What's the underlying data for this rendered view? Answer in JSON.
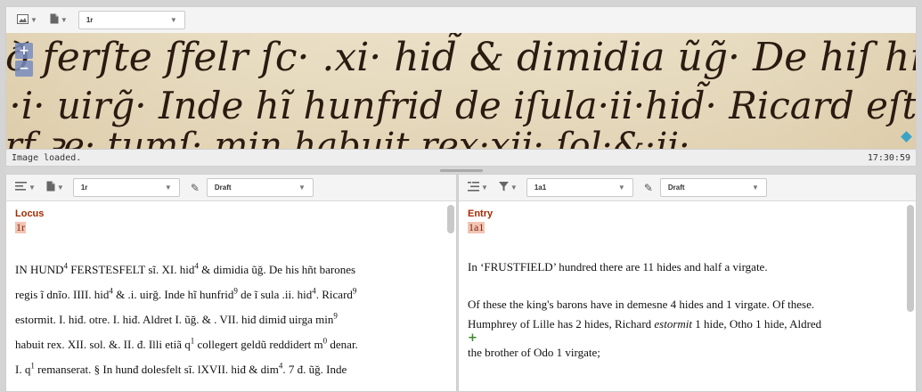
{
  "top_toolbar": {
    "image_icon": "image-icon",
    "page_icon": "page-icon",
    "folio_select": "1r"
  },
  "image_viewer": {
    "zoom_in": "+",
    "zoom_out": "−"
  },
  "status": {
    "message": "Image loaded.",
    "time": "17:30:59"
  },
  "left_panel": {
    "folio_select": "1r",
    "status_select": "Draft",
    "heading": "Locus",
    "locus_value": "1r",
    "lines": [
      [
        "IN HUND",
        "4",
        " FERSTESFELT sĩ. XI. hid",
        "4",
        " & dimidia ũğ. De his hñt barones"
      ],
      [
        "regis ĩ dnĩo. IIII. hid",
        "4",
        " & .i. uirğ. Inde hĩ hunfrid",
        "9",
        " de ĩ sula .ii. hid",
        "4",
        ". Ricard",
        "9",
        ""
      ],
      [
        "estormit. I. hiđ. otre. I. hiđ. Aldret I. ũğ. & . VII. hiđ dimiđ uirga min",
        "9",
        ""
      ],
      [
        "habuit rex. XII. sol. &. II. đ. Illi etiã q",
        "1",
        " collegert geldũ reddidert m",
        "0",
        " denar."
      ],
      [
        "I. q",
        "1",
        " remanserat. § In hunđ dolesfelt sĩ. lXVII. hiđ & dim",
        "4",
        ". 7 đ. ũğ. Inde"
      ]
    ]
  },
  "right_panel": {
    "entry_select": "1a1",
    "status_select": "Draft",
    "heading": "Entry",
    "entry_value": "1a1",
    "para1": "In ‘FRUSTFIELD’ hundred there are 11 hides and half a virgate.",
    "para2_a": "Of these the king's barons have in demesne 4 hides and 1 virgate. Of these.",
    "para2_b1": "Humphrey of Lille has 2 hides, Richard ",
    "para2_b_em": "estormit",
    "para2_b2": " 1 hide, Otho 1 hide, Aldred",
    "para2_c": "the brother of Odo 1 virgate;",
    "add_marker": "+"
  }
}
